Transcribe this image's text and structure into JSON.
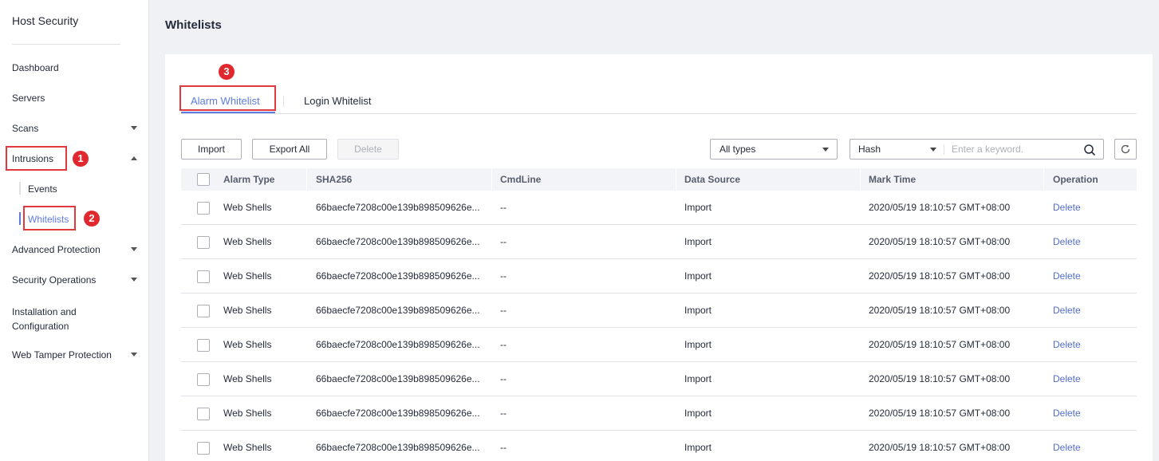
{
  "sidebar": {
    "title": "Host Security",
    "items": {
      "dashboard": "Dashboard",
      "servers": "Servers",
      "scans": "Scans",
      "intrusions": "Intrusions",
      "events": "Events",
      "whitelists": "Whitelists",
      "advanced_protection": "Advanced Protection",
      "security_operations": "Security Operations",
      "installation_line1": "Installation and",
      "installation_line2": "Configuration",
      "web_tamper": "Web Tamper Protection"
    }
  },
  "callouts": [
    "1",
    "2",
    "3"
  ],
  "header": {
    "title": "Whitelists"
  },
  "tabs": {
    "alarm": "Alarm Whitelist",
    "login": "Login Whitelist"
  },
  "toolbar": {
    "import": "Import",
    "export_all": "Export All",
    "delete": "Delete",
    "type_filter": "All types",
    "search_field": "Hash",
    "search_placeholder": "Enter a keyword."
  },
  "table": {
    "columns": [
      "Alarm Type",
      "SHA256",
      "CmdLine",
      "Data Source",
      "Mark Time",
      "Operation"
    ],
    "rows": [
      [
        "Web Shells",
        "66baecfe7208c00e139b898509626e...",
        "--",
        "Import",
        "2020/05/19 18:10:57 GMT+08:00",
        "Delete"
      ],
      [
        "Web Shells",
        "66baecfe7208c00e139b898509626e...",
        "--",
        "Import",
        "2020/05/19 18:10:57 GMT+08:00",
        "Delete"
      ],
      [
        "Web Shells",
        "66baecfe7208c00e139b898509626e...",
        "--",
        "Import",
        "2020/05/19 18:10:57 GMT+08:00",
        "Delete"
      ],
      [
        "Web Shells",
        "66baecfe7208c00e139b898509626e...",
        "--",
        "Import",
        "2020/05/19 18:10:57 GMT+08:00",
        "Delete"
      ],
      [
        "Web Shells",
        "66baecfe7208c00e139b898509626e...",
        "--",
        "Import",
        "2020/05/19 18:10:57 GMT+08:00",
        "Delete"
      ],
      [
        "Web Shells",
        "66baecfe7208c00e139b898509626e...",
        "--",
        "Import",
        "2020/05/19 18:10:57 GMT+08:00",
        "Delete"
      ],
      [
        "Web Shells",
        "66baecfe7208c00e139b898509626e...",
        "--",
        "Import",
        "2020/05/19 18:10:57 GMT+08:00",
        "Delete"
      ],
      [
        "Web Shells",
        "66baecfe7208c00e139b898509626e...",
        "--",
        "Import",
        "2020/05/19 18:10:57 GMT+08:00",
        "Delete"
      ]
    ]
  },
  "colors": {
    "accent": "#5e7ce0",
    "link": "#526ecc",
    "callout": "#e0393e"
  }
}
